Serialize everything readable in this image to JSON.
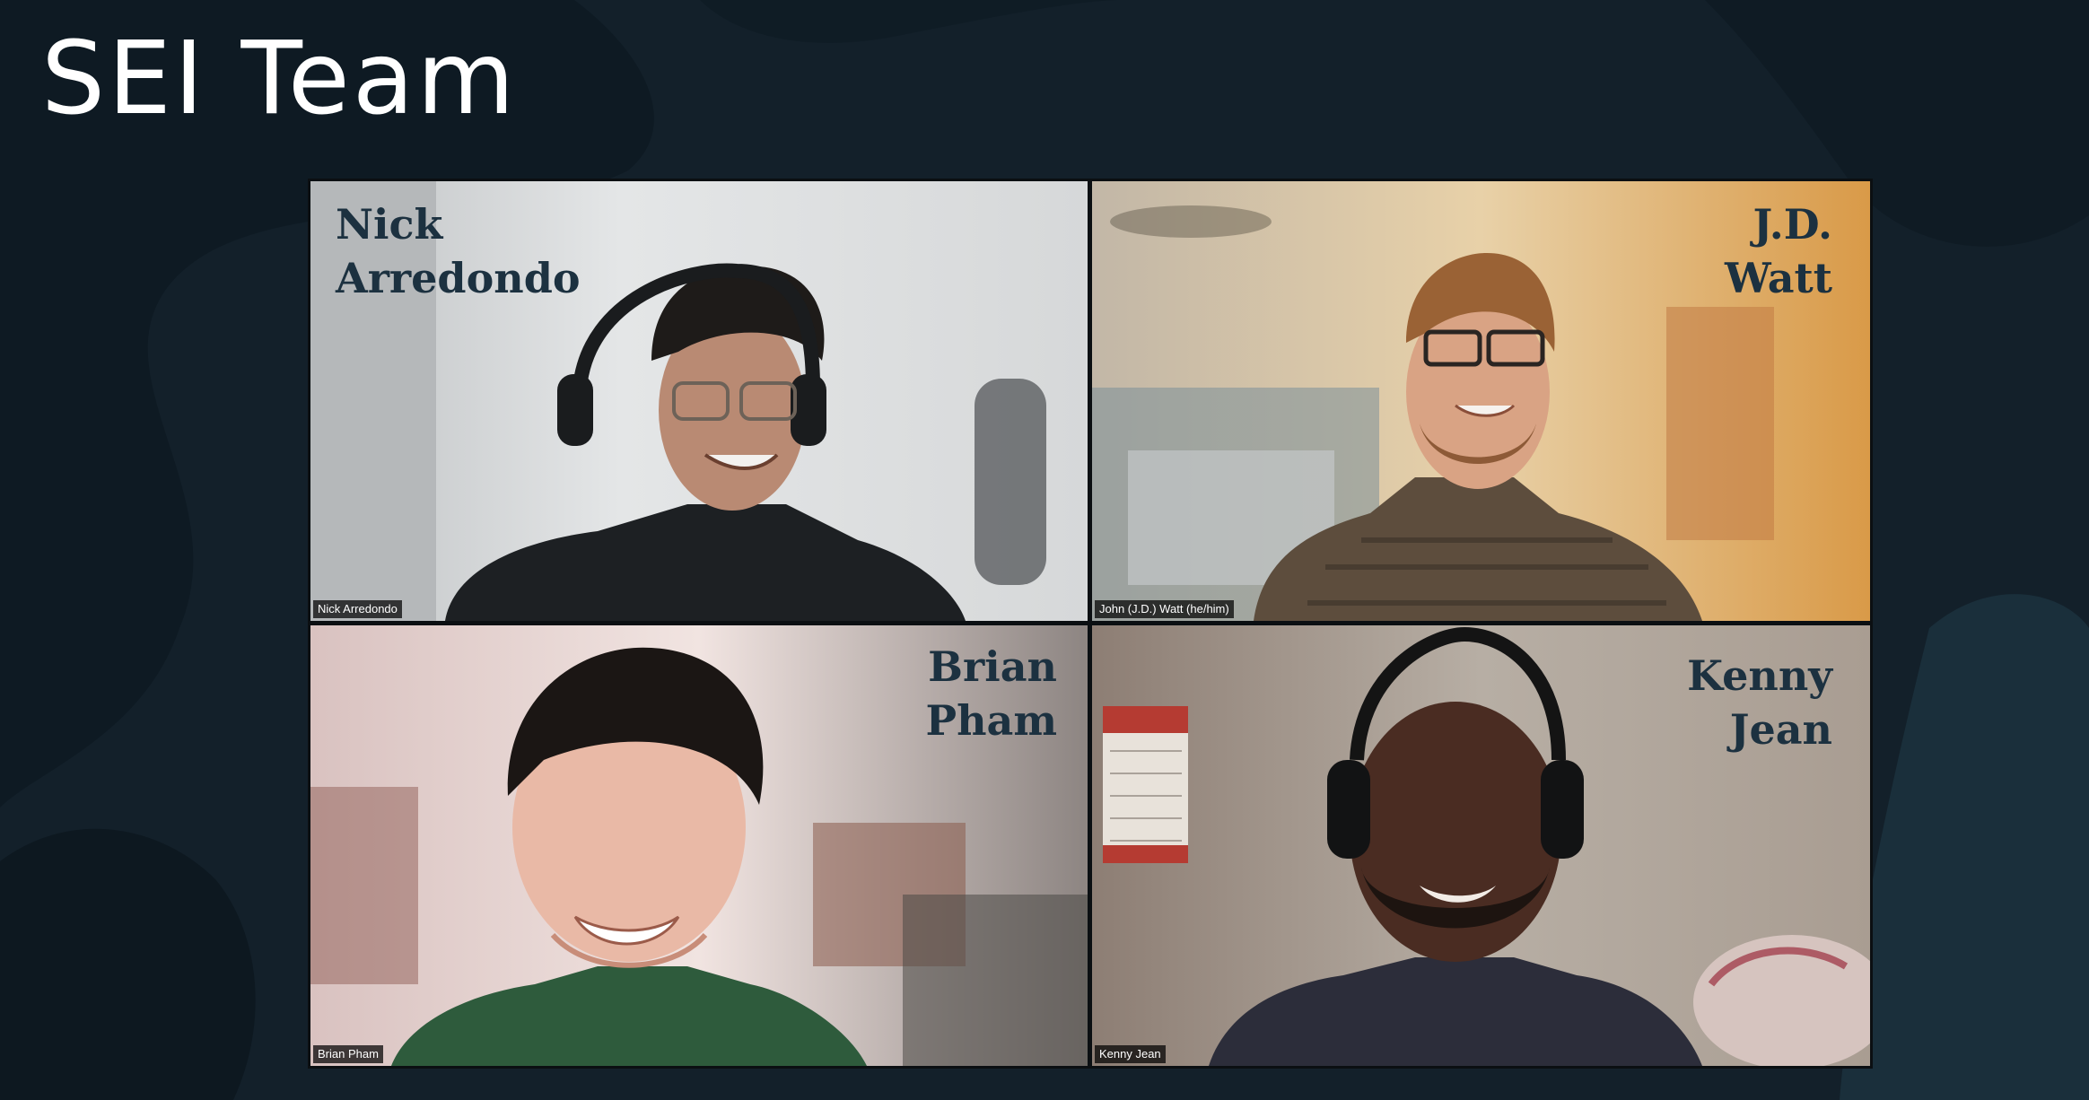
{
  "header": {
    "title": "SEI Team"
  },
  "participants": [
    {
      "overlay_first": "Nick",
      "overlay_last": "Arredondo",
      "name_label": "Nick Arredondo",
      "active_speaker": false
    },
    {
      "overlay_first": "J.D.",
      "overlay_last": "Watt",
      "name_label": "John (J.D.) Watt  (he/him)",
      "active_speaker": true
    },
    {
      "overlay_first": "Brian",
      "overlay_last": "Pham",
      "name_label": "Brian Pham",
      "active_speaker": false
    },
    {
      "overlay_first": "Kenny",
      "overlay_last": "Jean",
      "name_label": "Kenny Jean",
      "active_speaker": false
    }
  ],
  "colors": {
    "background": "#13202a",
    "overlay_text": "#1c3140",
    "active_speaker_border": "#d7e37a"
  }
}
